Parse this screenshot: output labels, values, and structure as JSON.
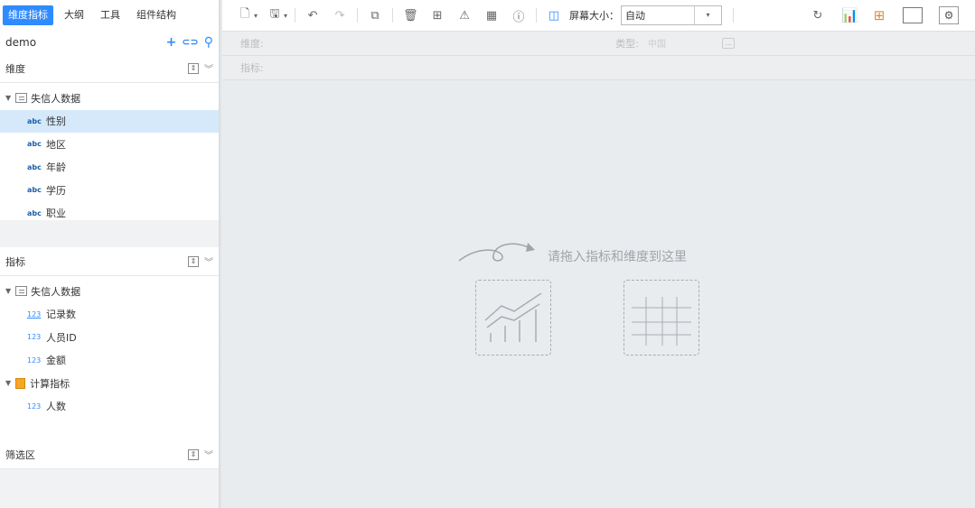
{
  "tabs": [
    "维度指标",
    "大纲",
    "工具",
    "组件结构"
  ],
  "datasource": {
    "name": "demo"
  },
  "dimension_section": {
    "title": "维度",
    "table_name": "失信人数据",
    "fields": [
      {
        "type": "abc",
        "name": "性别",
        "selected": true
      },
      {
        "type": "abc",
        "name": "地区"
      },
      {
        "type": "abc",
        "name": "年龄"
      },
      {
        "type": "abc",
        "name": "学历"
      },
      {
        "type": "abc",
        "name": "职业"
      }
    ]
  },
  "index_section": {
    "title": "指标",
    "table_name": "失信人数据",
    "fields": [
      {
        "type": "123",
        "name": "记录数"
      },
      {
        "type": "123",
        "name": "人员ID"
      },
      {
        "type": "123",
        "name": "金额"
      }
    ],
    "calc_group": "计算指标",
    "calc_fields": [
      {
        "type": "123",
        "name": "人数"
      }
    ]
  },
  "filter_section": {
    "title": "筛选区"
  },
  "toolbar": {
    "screen_label": "屏幕大小：",
    "screen_value": "自动"
  },
  "drop_rows": {
    "dimension_label": "维度:",
    "type_label": "类型:",
    "type_value": "中国",
    "index_label": "指标:"
  },
  "canvas": {
    "hint": "请拖入指标和维度到这里"
  },
  "colors": {
    "accent": "#2f8bff",
    "selected_row": "#d5e9fb",
    "canvas_bg": "#e9ecef"
  }
}
